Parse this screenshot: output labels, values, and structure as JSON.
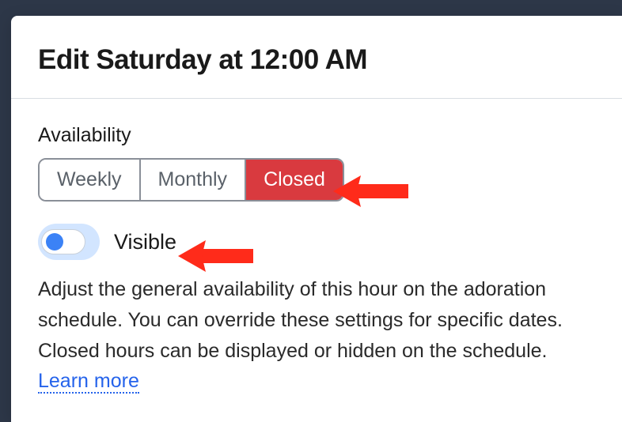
{
  "modal": {
    "title": "Edit Saturday at 12:00 AM"
  },
  "availability": {
    "label": "Availability",
    "options": {
      "weekly": "Weekly",
      "monthly": "Monthly",
      "closed": "Closed"
    },
    "selected": "closed"
  },
  "toggle": {
    "label": "Visible",
    "state": true
  },
  "description": {
    "text": "Adjust the general availability of this hour on the adoration schedule. You can override these settings for specific dates. Closed hours can be displayed or hidden on the schedule. ",
    "learn_more": "Learn more"
  }
}
